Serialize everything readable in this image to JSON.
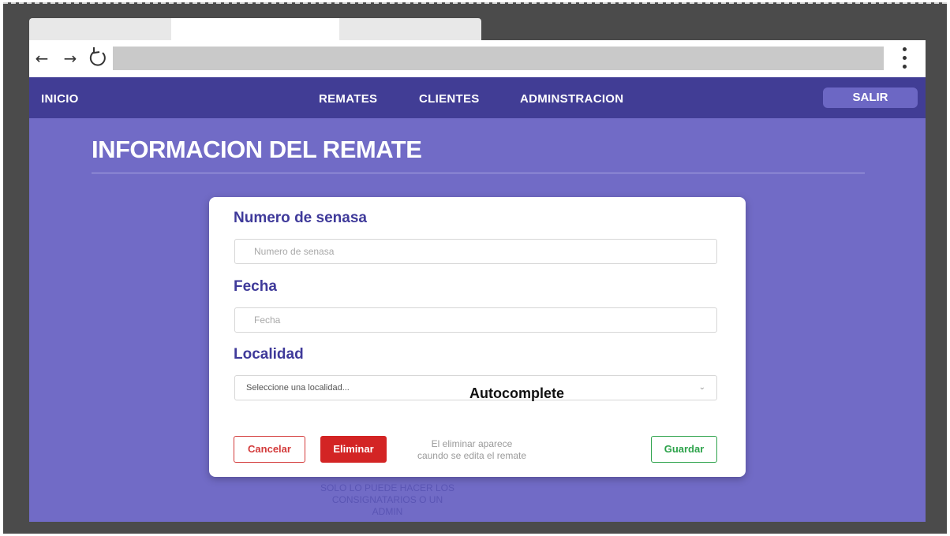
{
  "browser": {
    "back_icon": "←",
    "forward_icon": "→",
    "reload_icon": "↻"
  },
  "navbar": {
    "home": "INICIO",
    "links": [
      "REMATES",
      "CLIENTES",
      "ADMINSTRACION"
    ],
    "logout": "SALIR"
  },
  "page": {
    "title": "INFORMACION DEL REMATE"
  },
  "form": {
    "senasa": {
      "label": "Numero de senasa",
      "placeholder": "Numero de senasa"
    },
    "fecha": {
      "label": "Fecha",
      "placeholder": "Fecha"
    },
    "localidad": {
      "label": "Localidad",
      "placeholder": "Seleccione una localidad...",
      "annotation": "Autocomplete",
      "chevron": "⌄"
    }
  },
  "actions": {
    "cancel": "Cancelar",
    "delete": "Eliminar",
    "delete_note_line1": "El eliminar aparece",
    "delete_note_line2": "caundo se edita el remate",
    "save": "Guardar"
  },
  "footer_note": {
    "line1": "SOLO LO PUEDE HACER LOS",
    "line2": "CONSIGNATARIOS O UN",
    "line3": "ADMIN"
  },
  "colors": {
    "navbar": "#413d95",
    "content_bg": "#716bc6",
    "label": "#3f3a9a",
    "danger": "#d32424",
    "success": "#2ca24a"
  }
}
